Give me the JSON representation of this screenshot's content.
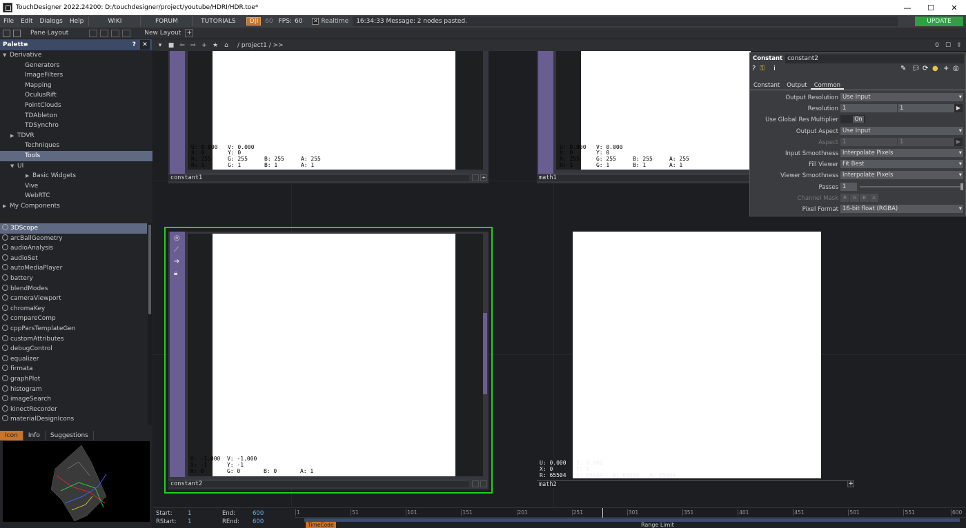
{
  "window": {
    "title": "TouchDesigner 2022.24200: D:/touchdesigner/project/youtube/HDRI/HDR.toe*",
    "minimize": "—",
    "maximize": "☐",
    "close": "✕"
  },
  "menu": {
    "items": [
      "File",
      "Edit",
      "Dialogs",
      "Help"
    ],
    "links": [
      "WIKI",
      "FORUM",
      "TUTORIALS"
    ],
    "oi": "O|I",
    "fps_target": "60",
    "fps_label": "FPS:",
    "fps_value": "60",
    "realtime_check": "✕",
    "realtime": "Realtime",
    "message": "16:34:33 Message: 2 nodes pasted.",
    "update": "UPDATE"
  },
  "pane_bar": {
    "pane_layout": "Pane Layout",
    "new_layout": "New Layout",
    "plus": "+"
  },
  "palette": {
    "title": "Palette",
    "help": "?",
    "close": "✕",
    "tree": [
      {
        "label": "Derivative",
        "indent": 0,
        "tri": "▼"
      },
      {
        "label": "Generators",
        "indent": 2,
        "tri": ""
      },
      {
        "label": "ImageFilters",
        "indent": 2,
        "tri": ""
      },
      {
        "label": "Mapping",
        "indent": 2,
        "tri": ""
      },
      {
        "label": "OculusRift",
        "indent": 2,
        "tri": ""
      },
      {
        "label": "PointClouds",
        "indent": 2,
        "tri": ""
      },
      {
        "label": "TDAbleton",
        "indent": 2,
        "tri": ""
      },
      {
        "label": "TDSynchro",
        "indent": 2,
        "tri": ""
      },
      {
        "label": "TDVR",
        "indent": 1,
        "tri": "▶"
      },
      {
        "label": "Techniques",
        "indent": 2,
        "tri": ""
      },
      {
        "label": "Tools",
        "indent": 2,
        "tri": "",
        "selected": true
      },
      {
        "label": "UI",
        "indent": 1,
        "tri": "▼"
      },
      {
        "label": "Basic Widgets",
        "indent": 3,
        "tri": "▶"
      },
      {
        "label": "Vive",
        "indent": 2,
        "tri": ""
      },
      {
        "label": "WebRTC",
        "indent": 2,
        "tri": ""
      },
      {
        "label": "My Components",
        "indent": 0,
        "tri": "▶"
      }
    ],
    "components": [
      "3DScope",
      "arcBallGeometry",
      "audioAnalysis",
      "audioSet",
      "autoMediaPlayer",
      "battery",
      "blendModes",
      "cameraViewport",
      "chromaKey",
      "compareComp",
      "cppParsTemplateGen",
      "customAttributes",
      "debugControl",
      "equalizer",
      "firmata",
      "graphPlot",
      "histogram",
      "imageSearch",
      "kinectRecorder",
      "materialDesignIcons"
    ],
    "tabs": [
      "Icon",
      "Info",
      "Suggestions"
    ]
  },
  "network": {
    "path": "/ project1 / >>",
    "zero": "0"
  },
  "nodes": {
    "constant1": {
      "name": "constant1",
      "info1": "U: 0.000   V: 0.000",
      "info2": "X: 0       Y: 0",
      "info3": "R: 255     G: 255     B: 255     A: 255",
      "info4": "R: 1       G: 1       B: 1       A: 1"
    },
    "math1": {
      "name": "math1",
      "info1": "U: 0.000   V: 0.000",
      "info2": "X: 0       Y: 0",
      "info3": "R: 255     G: 255     B: 255     A: 255",
      "info4": "R: 1       G: 1       B: 1       A: 1"
    },
    "constant2": {
      "name": "constant2",
      "info1": "U: -1.000  V: -1.000",
      "info2": "X: -1      Y: -1",
      "info3": "R: 0       G: 0       B: 0       A: 1"
    },
    "math2": {
      "name": "math2",
      "info1": "U: 0.000   V: 0.000",
      "info2": "X: 0       Y: 0",
      "info3": "R: 65504   G: 65504   B: 65504   A: 65504"
    }
  },
  "params": {
    "type": "Constant",
    "name": "constant2",
    "tabs": [
      "Constant",
      "Output",
      "Common"
    ],
    "active_tab": "Common",
    "output_resolution": {
      "label": "Output Resolution",
      "value": "Use Input"
    },
    "resolution": {
      "label": "Resolution",
      "w": "1",
      "h": "1"
    },
    "global_res": {
      "label": "Use Global Res Multiplier",
      "value": "On"
    },
    "output_aspect": {
      "label": "Output Aspect",
      "value": "Use Input"
    },
    "aspect": {
      "label": "Aspect",
      "a": "1",
      "b": "1"
    },
    "input_smoothness": {
      "label": "Input Smoothness",
      "value": "Interpolate Pixels"
    },
    "fill_viewer": {
      "label": "Fill Viewer",
      "value": "Fit Best"
    },
    "viewer_smoothness": {
      "label": "Viewer Smoothness",
      "value": "Interpolate Pixels"
    },
    "passes": {
      "label": "Passes",
      "value": "1"
    },
    "channel_mask": {
      "label": "Channel Mask",
      "chans": [
        "R",
        "G",
        "B",
        "A"
      ]
    },
    "pixel_format": {
      "label": "Pixel Format",
      "value": "16-bit float (RGBA)"
    }
  },
  "timeline": {
    "start_label": "Start:",
    "start": "1",
    "end_label": "End:",
    "end": "600",
    "rstart_label": "RStart:",
    "rstart": "1",
    "rend_label": "REnd:",
    "rend": "600",
    "ticks": [
      "1",
      "51",
      "101",
      "151",
      "201",
      "251",
      "301",
      "351",
      "401",
      "451",
      "501",
      "551",
      "600"
    ],
    "timecode": "TimeCode",
    "range_limit": "Range Limit"
  }
}
